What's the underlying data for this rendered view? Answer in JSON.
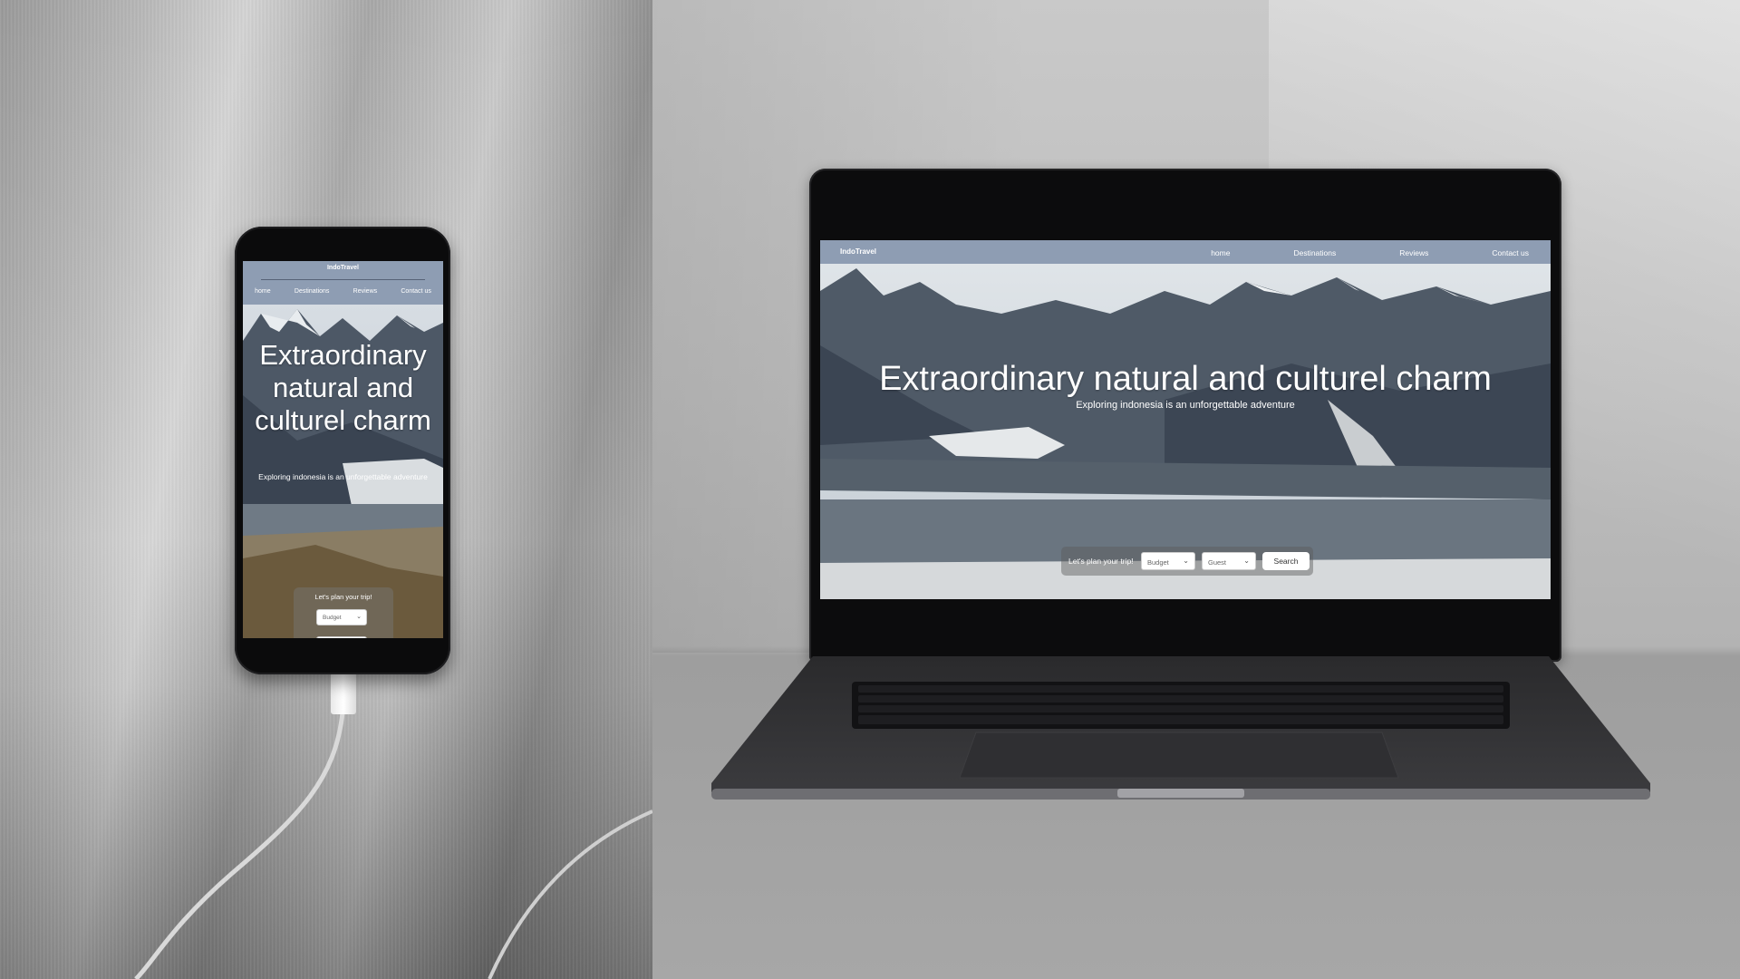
{
  "site": {
    "brand": "IndoTravel",
    "nav": [
      "home",
      "Destinations",
      "Reviews",
      "Contact us"
    ],
    "hero_title": "Extraordinary natural and culturel charm",
    "hero_subtitle": "Exploring indonesia is an unforgettable adventure",
    "plan_label": "Let's plan your trip!",
    "budget_placeholder": "Budget",
    "guest_placeholder": "Guest",
    "search_label": "Search"
  },
  "colors": {
    "header": "#8e9db3",
    "text": "#ffffff",
    "device_bezel": "#0c0c0d"
  }
}
